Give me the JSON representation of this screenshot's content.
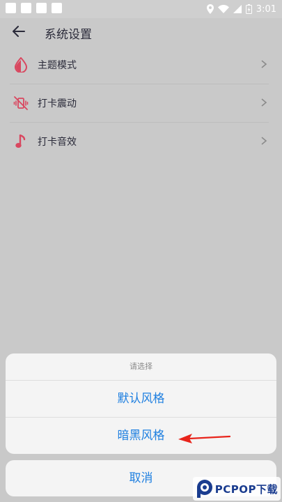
{
  "status_bar": {
    "time": "3:01"
  },
  "app_bar": {
    "title": "系统设置"
  },
  "settings": [
    {
      "label": "主题模式",
      "icon": "theme-drop-icon"
    },
    {
      "label": "打卡震动",
      "icon": "vibrate-off-icon"
    },
    {
      "label": "打卡音效",
      "icon": "music-note-icon"
    }
  ],
  "action_sheet": {
    "title": "请选择",
    "options": [
      "默认风格",
      "暗黑风格"
    ],
    "cancel": "取消"
  },
  "watermark": {
    "text": "PCPOP下载"
  },
  "colors": {
    "accent_blue": "#1e7fe0",
    "icon_red": "#d9475f",
    "overlay_gray": "#c9c9c9",
    "arrow_red": "#e8241b"
  }
}
